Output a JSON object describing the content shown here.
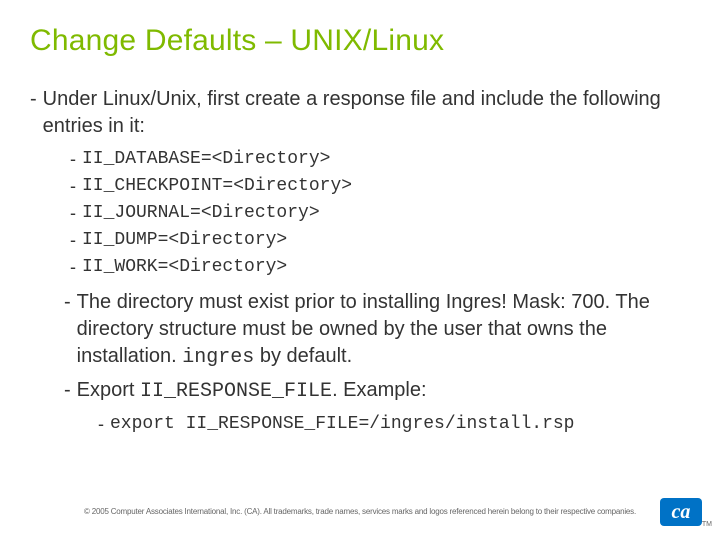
{
  "title": "Change Defaults – UNIX/Linux",
  "intro_dash": "-",
  "intro": "Under Linux/Unix, first create a response file and include the following entries in it:",
  "entries": {
    "d": "-",
    "e1": "II_DATABASE=<Directory>",
    "e2": "II_CHECKPOINT=<Directory>",
    "e3": "II_JOURNAL=<Directory>",
    "e4": "II_DUMP=<Directory>",
    "e5": "II_WORK=<Directory>"
  },
  "note1": {
    "dash": "-",
    "a": "The directory must exist prior to installing Ingres!  Mask: 700.  The directory structure must be owned by the user that owns the installation.  ",
    "b": "ingres",
    "c": " by default."
  },
  "note2": {
    "dash": "-",
    "a": "Export ",
    "b": "II_RESPONSE_FILE",
    "c": ".  Example:"
  },
  "example": {
    "dash": "-",
    "text": "export II_RESPONSE_FILE=/ingres/install.rsp"
  },
  "copyright": "© 2005 Computer Associates International, Inc. (CA). All trademarks, trade names, services marks and logos referenced herein belong to their respective companies.",
  "logo": {
    "text": "ca",
    "tm": "TM"
  }
}
